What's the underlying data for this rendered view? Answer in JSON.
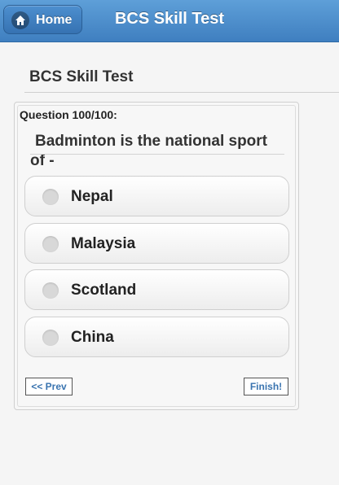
{
  "header": {
    "home_label": "Home",
    "title": "BCS Skill Test"
  },
  "page": {
    "heading": "BCS Skill Test"
  },
  "question": {
    "number_label": "Question 100/100:",
    "text": "Badminton is the national sport of -"
  },
  "options": [
    {
      "label": "Nepal"
    },
    {
      "label": "Malaysia"
    },
    {
      "label": "Scotland"
    },
    {
      "label": "China"
    }
  ],
  "navigation": {
    "prev_label": "<< Prev",
    "finish_label": "Finish!"
  },
  "colors": {
    "header": "#4a8ccc",
    "link": "#3a74b0"
  }
}
